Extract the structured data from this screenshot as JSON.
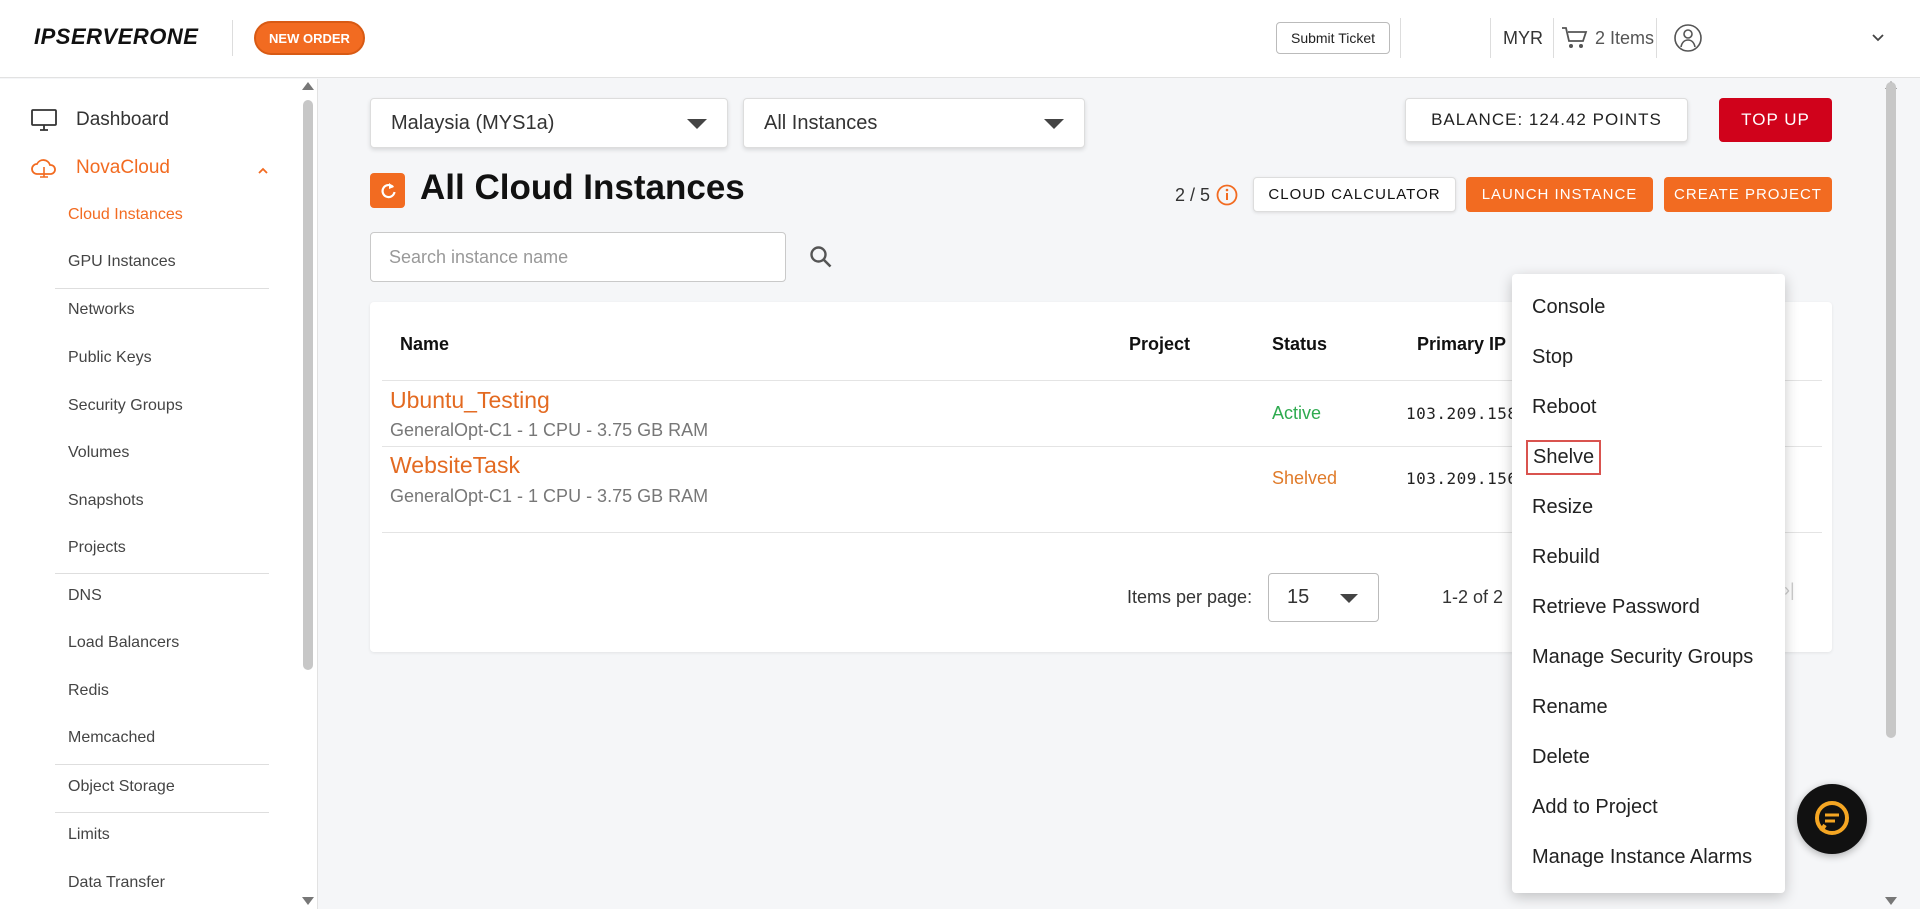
{
  "header": {
    "logo": "IPSERVERONE",
    "new_order": "NEW ORDER",
    "submit_ticket": "Submit Ticket",
    "currency": "MYR",
    "cart_label": "2 Items"
  },
  "sidebar": {
    "dashboard": "Dashboard",
    "novacloud": "NovaCloud",
    "items": [
      "Cloud Instances",
      "GPU Instances",
      "Networks",
      "Public Keys",
      "Security Groups",
      "Volumes",
      "Snapshots",
      "Projects",
      "DNS",
      "Load Balancers",
      "Redis",
      "Memcached",
      "Object Storage",
      "Limits",
      "Data Transfer"
    ],
    "active_item": "Cloud Instances"
  },
  "filters": {
    "region": "Malaysia (MYS1a)",
    "instance_filter": "All Instances"
  },
  "balance": {
    "label": "BALANCE: 124.42 POINTS",
    "top_up": "TOP UP"
  },
  "page": {
    "title": "All Cloud Instances",
    "quota": "2 / 5",
    "cloud_calculator": "CLOUD CALCULATOR",
    "launch_instance": "LAUNCH INSTANCE",
    "create_project": "CREATE PROJECT",
    "search_placeholder": "Search instance name"
  },
  "table": {
    "columns": [
      "Name",
      "Project",
      "Status",
      "Primary IP"
    ],
    "rows": [
      {
        "name": "Ubuntu_Testing",
        "spec": "GeneralOpt-C1 - 1 CPU - 3.75 GB RAM",
        "project": "",
        "status": "Active",
        "ip": "103.209.158."
      },
      {
        "name": "WebsiteTask",
        "spec": "GeneralOpt-C1 - 1 CPU - 3.75 GB RAM",
        "project": "",
        "status": "Shelved",
        "ip": "103.209.156."
      }
    ]
  },
  "pagination": {
    "items_per_page_label": "Items per page:",
    "items_per_page": "15",
    "range": "1-2 of 2",
    "last_page_glyph": "›|"
  },
  "context_menu": {
    "items": [
      "Console",
      "Stop",
      "Reboot",
      "Shelve",
      "Resize",
      "Rebuild",
      "Retrieve Password",
      "Manage Security Groups",
      "Rename",
      "Delete",
      "Add to Project",
      "Manage Instance Alarms"
    ],
    "highlighted": "Shelve"
  },
  "colors": {
    "accent": "#f26b21",
    "top_up": "#d0021b",
    "active": "#2eaa4f",
    "shelved": "#e07b2a"
  }
}
